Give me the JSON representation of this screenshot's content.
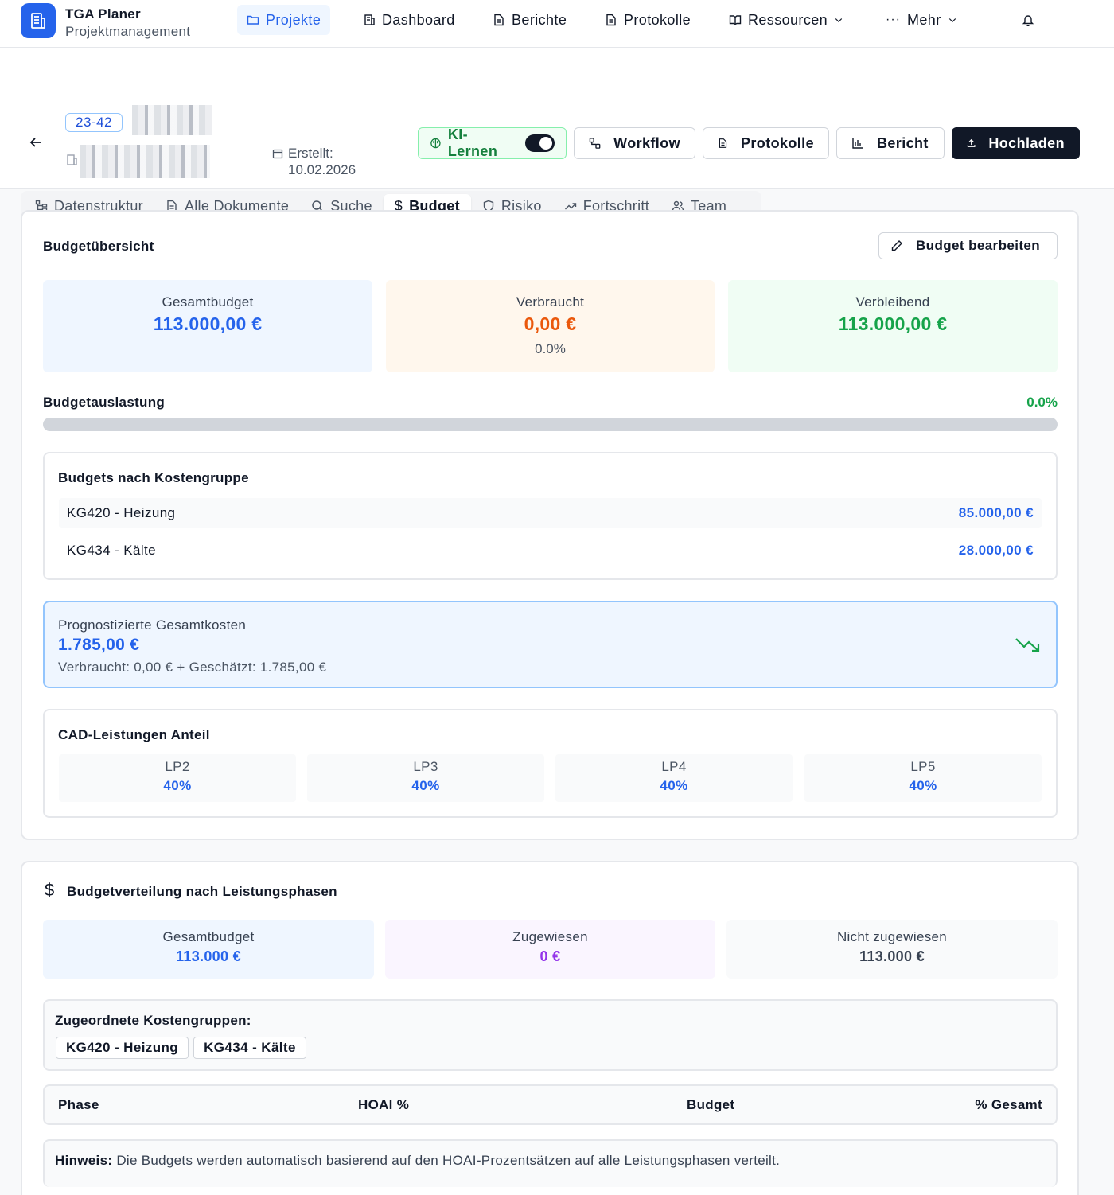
{
  "app": {
    "title": "TGA Planer",
    "subtitle": "Projektmanagement"
  },
  "nav": {
    "projekte": "Projekte",
    "dashboard": "Dashboard",
    "berichte": "Berichte",
    "protokolle": "Protokolle",
    "ressourcen": "Ressourcen",
    "mehr": "Mehr"
  },
  "project": {
    "id": "23-42",
    "created_label": "Erstellt:",
    "created_date": "10.02.2026"
  },
  "actions": {
    "ki": "KI-Lernen",
    "ki_enabled": true,
    "workflow": "Workflow",
    "protokolle": "Protokolle",
    "bericht": "Bericht",
    "upload": "Hochladen"
  },
  "tabs": {
    "datenstruktur": "Datenstruktur",
    "dokumente": "Alle Dokumente",
    "suche": "Suche",
    "budget": "Budget",
    "risiko": "Risiko",
    "fortschritt": "Fortschritt",
    "team": "Team"
  },
  "overview": {
    "title": "Budgetübersicht",
    "edit": "Budget bearbeiten",
    "total_label": "Gesamtbudget",
    "total_value": "113.000,00 €",
    "used_label": "Verbraucht",
    "used_value": "0,00 €",
    "used_pct": "0.0%",
    "remaining_label": "Verbleibend",
    "remaining_value": "113.000,00 €",
    "usage_label": "Budgetauslastung",
    "usage_pct": "0.0%",
    "usage_fraction": 0.0
  },
  "kostengruppen": {
    "title": "Budgets nach Kostengruppe",
    "rows": [
      {
        "name": "KG420 - Heizung",
        "amount": "85.000,00 €"
      },
      {
        "name": "KG434 - Kälte",
        "amount": "28.000,00 €"
      }
    ]
  },
  "forecast": {
    "label": "Prognostizierte Gesamtkosten",
    "value": "1.785,00 €",
    "detail": "Verbraucht: 0,00 € + Geschätzt: 1.785,00 €"
  },
  "cad": {
    "title": "CAD-Leistungen Anteil",
    "phases": [
      {
        "name": "LP2",
        "pct": "40%"
      },
      {
        "name": "LP3",
        "pct": "40%"
      },
      {
        "name": "LP4",
        "pct": "40%"
      },
      {
        "name": "LP5",
        "pct": "40%"
      }
    ]
  },
  "distribution": {
    "title": "Budgetverteilung nach Leistungsphasen",
    "total_label": "Gesamtbudget",
    "total_value": "113.000 €",
    "assigned_label": "Zugewiesen",
    "assigned_value": "0 €",
    "unassigned_label": "Nicht zugewiesen",
    "unassigned_value": "113.000 €",
    "groups_label": "Zugeordnete Kostengruppen:",
    "groups": [
      "KG420 - Heizung",
      "KG434 - Kälte"
    ],
    "table_headers": [
      "Phase",
      "HOAI %",
      "Budget",
      "% Gesamt"
    ],
    "note_bold": "Hinweis:",
    "note_text": " Die Budgets werden automatisch basierend auf den HOAI-Prozentsätzen auf alle Leistungsphasen verteilt."
  },
  "colors": {
    "accent": "#2563eb",
    "orange": "#ea580c",
    "green": "#16a34a",
    "purple": "#9333ea"
  }
}
